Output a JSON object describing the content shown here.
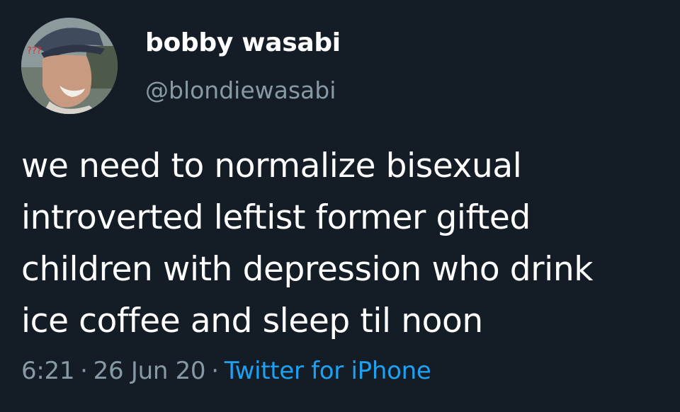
{
  "user": {
    "display_name": "bobby wasabi",
    "handle": "@blondiewasabi",
    "avatar_caption": "???"
  },
  "tweet": {
    "lines": [
      "we need to normalize bisexual",
      "introverted leftist former gifted",
      "children with depression who drink",
      "ice coffee and sleep til noon"
    ]
  },
  "meta": {
    "time": "6:21",
    "separator": "·",
    "date": "26 Jun 20",
    "source": "Twitter for iPhone"
  },
  "colors": {
    "background": "#141d26",
    "text": "#ffffff",
    "secondary_text": "#8899a6",
    "link": "#1da1f2"
  }
}
